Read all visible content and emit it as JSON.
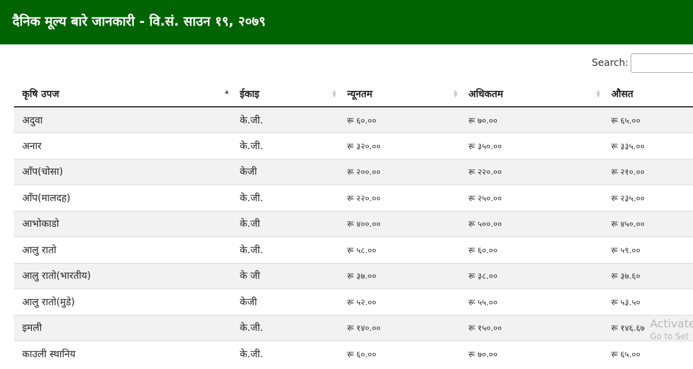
{
  "header": {
    "title": "दैनिक मूल्य बारे जानकारी - वि.सं. साउन १९, २०७९",
    "bg_color": "#006400"
  },
  "search": {
    "label": "Search:",
    "value": ""
  },
  "table": {
    "columns": [
      {
        "label": "कृषि उपज",
        "sort": "asc"
      },
      {
        "label": "ईकाइ",
        "sort": "none"
      },
      {
        "label": "न्यूनतम",
        "sort": "none"
      },
      {
        "label": "अधिकतम",
        "sort": "none"
      },
      {
        "label": "औसत",
        "sort": "none"
      }
    ],
    "rows": [
      [
        "अदुवा",
        "के.जी.",
        "रू ६०.००",
        "रू ७०.००",
        "रू ६५.००"
      ],
      [
        "अनार",
        "के.जी.",
        "रू ३२०.००",
        "रू ३५०.००",
        "रू ३३५.००"
      ],
      [
        "आँप(चोसा)",
        "केजी",
        "रू २००.००",
        "रू २२०.००",
        "रू २१०.००"
      ],
      [
        "आँप(मालदह)",
        "के.जी.",
        "रू २२०.००",
        "रू २५०.००",
        "रू २३५.००"
      ],
      [
        "आभोकाडो",
        "के.जी",
        "रू ४००.००",
        "रू ५००.००",
        "रू ४५०.००"
      ],
      [
        "आलु रातो",
        "के.जी.",
        "रू ५८.००",
        "रू ६०.००",
        "रू ५९.००"
      ],
      [
        "आलु रातो(भारतीय)",
        "के जी",
        "रू ३७.००",
        "रू ३८.००",
        "रू ३७.६०"
      ],
      [
        "आलु रातो(मुडे)",
        "केजी",
        "रू ५२.००",
        "रू ५५.००",
        "रू ५३.५०"
      ],
      [
        "इमली",
        "के.जी.",
        "रू १४०.००",
        "रू १५०.००",
        "रू १४६.६७"
      ],
      [
        "काउली स्थानिय",
        "के.जी.",
        "रू ६०.००",
        "रू ७०.००",
        "रू ६५.००"
      ]
    ]
  },
  "watermark": {
    "line1": "Activate",
    "line2": "Go to Set"
  }
}
